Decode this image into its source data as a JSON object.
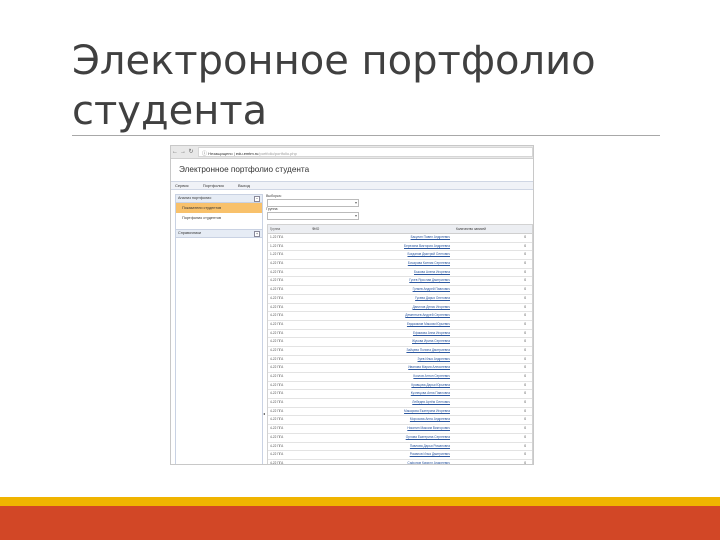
{
  "slide": {
    "title": "Электронное портфолио студента",
    "colors": {
      "accent_yellow": "#f0b400",
      "accent_red": "#d24726",
      "title_text": "#404040"
    }
  },
  "browser": {
    "back_icon": "arrow-left-icon",
    "url_secure": "Незащищено",
    "url_host": "edu.emtm.ru",
    "url_path": "/portfolio/portfolio.php"
  },
  "app": {
    "title": "Электронное портфолио студента",
    "menu": [
      "Сервис",
      "Портфолио",
      "Выход"
    ],
    "sidebar": {
      "section1": "Анализ портфолио",
      "items": [
        "Показатели студентов",
        "Портфолио студентов"
      ],
      "section2": "Справочники"
    },
    "filters": {
      "label1": "Выборка:",
      "label2": "Группа:"
    },
    "grid": {
      "headers": [
        "Группа",
        "ФИО",
        "Количество записей"
      ],
      "rows": [
        [
          "1-22 ПГА",
          "Бакулин Павел Андреевич",
          "0"
        ],
        [
          "1-22 ПГА",
          "Березина Виктория Андреевна",
          "0"
        ],
        [
          "1-22 ПГА",
          "Богданов Дмитрий Олегович",
          "0"
        ],
        [
          "4-22 ПГА",
          "Бочарова Ксения Сергеевна",
          "0"
        ],
        [
          "4-22 ПГА",
          "Быкова Алена Игоревна",
          "0"
        ],
        [
          "4-22 ПГА",
          "Гусев Ярослав Дмитриевич",
          "0"
        ],
        [
          "4-22 ПГА",
          "Гуляев Андрей Павлович",
          "0"
        ],
        [
          "4-22 ПГА",
          "Гусева Дарья Олеговна",
          "0"
        ],
        [
          "4-22 ПГА",
          "Данилов Денис Игоревич",
          "0"
        ],
        [
          "4-22 ПГА",
          "Дементьев Андрей Сергеевич",
          "0"
        ],
        [
          "4-22 ПГА",
          "Евдокимов Максим Юрьевич",
          "0"
        ],
        [
          "4-22 ПГА",
          "Ефимова Анна Игоревна",
          "0"
        ],
        [
          "4-22 ПГА",
          "Жукова Ирина Сергеевна",
          "0"
        ],
        [
          "4-22 ПГА",
          "Зайцева Полина Дмитриевна",
          "0"
        ],
        [
          "4-22 ПГА",
          "Зуев Илья Андреевич",
          "0"
        ],
        [
          "4-22 ПГА",
          "Иванова Мария Алексеевна",
          "0"
        ],
        [
          "4-22 ПГА",
          "Козлов Антон Сергеевич",
          "0"
        ],
        [
          "4-22 ПГА",
          "Кравцова Дарья Юрьевна",
          "0"
        ],
        [
          "4-22 ПГА",
          "Кузнецова Анна Павловна",
          "0"
        ],
        [
          "4-22 ПГА",
          "Лебедев Артём Олегович",
          "0"
        ],
        [
          "4-22 ПГА",
          "Макарова Екатерина Игоревна",
          "0"
        ],
        [
          "4-22 ПГА",
          "Морозова Анна Андреевна",
          "0"
        ],
        [
          "4-22 ПГА",
          "Никитин Максим Викторович",
          "0"
        ],
        [
          "4-22 ПГА",
          "Орлова Екатерина Сергеевна",
          "0"
        ],
        [
          "4-22 ПГА",
          "Павлова Дарья Романовна",
          "0"
        ],
        [
          "4-22 ПГА",
          "Романов Илья Дмитриевич",
          "0"
        ],
        [
          "4-22 ПГА",
          "Сафонов Кирилл Андреевич",
          "0"
        ],
        [
          "4-22 ПГА",
          "Смирнова Ольга Алексеевна",
          "0"
        ]
      ]
    }
  }
}
